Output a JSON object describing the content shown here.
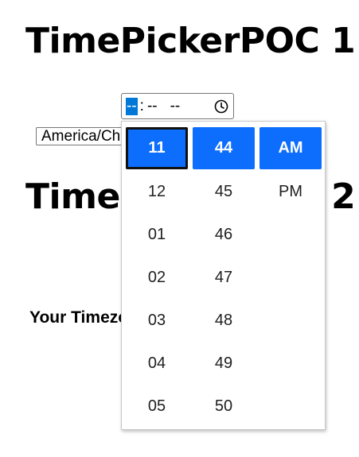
{
  "page": {
    "title1": "TimePickerPOC 1",
    "title2": "TimePickerPOC 2",
    "your_timezone_label": "Your Timezone:"
  },
  "time_input": {
    "hour": "--",
    "minute": "--",
    "period": "--",
    "separator": ":",
    "icon": "clock-icon"
  },
  "timezone_select": {
    "value": "America/Chicago"
  },
  "picker": {
    "hours": [
      "11",
      "12",
      "01",
      "02",
      "03",
      "04",
      "05"
    ],
    "minutes": [
      "44",
      "45",
      "46",
      "47",
      "48",
      "49",
      "50"
    ],
    "periods": [
      "AM",
      "PM"
    ],
    "selected": {
      "hour": "11",
      "minute": "44",
      "period": "AM"
    },
    "accent_color": "#0d6efd"
  }
}
